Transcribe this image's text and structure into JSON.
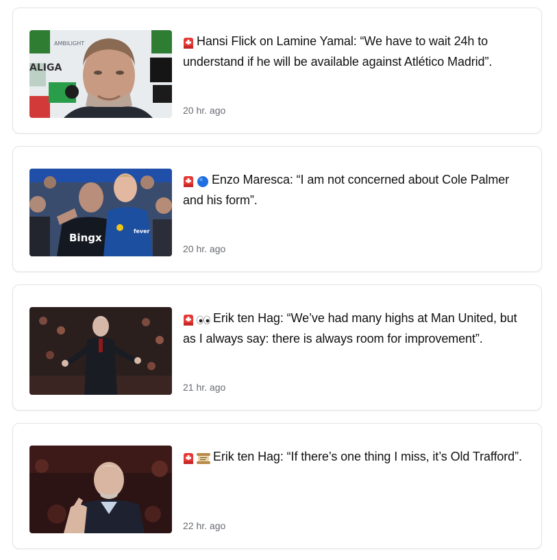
{
  "items": [
    {
      "headline": "Hansi Flick on Lamine Yamal: “We have to wait 24h to understand if he will be available against Atlético Madrid”.",
      "time": "20 hr. ago",
      "emojis": [
        "siren-icon"
      ],
      "thumb_text": [
        "AMBILIGHT",
        "ALIGA"
      ]
    },
    {
      "headline": "Enzo Maresca: “I am not concerned about Cole Palmer and his form”.",
      "time": "20 hr. ago",
      "emojis": [
        "siren-icon",
        "blue-circle-icon"
      ],
      "thumb_text": [
        "Bingx",
        "fever"
      ]
    },
    {
      "headline": "Erik ten Hag: “We’ve had many highs at Man United, but as I always say: there is always room for improvement”.",
      "time": "21 hr. ago",
      "emojis": [
        "siren-icon",
        "eyes-icon"
      ],
      "thumb_text": []
    },
    {
      "headline": "Erik ten Hag: “If there’s one thing I miss, it’s Old Trafford”.",
      "time": "22 hr. ago",
      "emojis": [
        "siren-icon",
        "scroll-icon"
      ],
      "thumb_text": []
    }
  ],
  "colors": {
    "border": "#e3e3e3",
    "time_text": "#666a70",
    "headline_text": "#111111",
    "siren_red": "#e53935",
    "chelsea_blue": "#1d4fa0"
  }
}
